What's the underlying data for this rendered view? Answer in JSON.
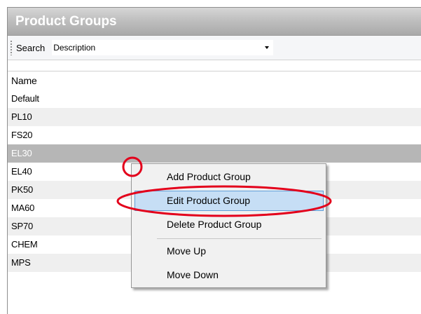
{
  "window": {
    "title": "Product Groups"
  },
  "toolbar": {
    "search_label": "Search",
    "search_value": "Description"
  },
  "grid": {
    "header": "Name",
    "rows": [
      "Default",
      "PL10",
      "FS20",
      "EL30",
      "EL40",
      "PK50",
      "MA60",
      "SP70",
      "CHEM",
      "MPS"
    ],
    "selected": "EL30"
  },
  "context_menu": {
    "items": [
      "Add Product Group",
      "Edit Product Group",
      "Delete Product Group",
      "Move Up",
      "Move Down"
    ],
    "highlighted": "Edit Product Group"
  },
  "colors": {
    "annotation": "#e3001b",
    "highlight": "#c6def5",
    "selection": "#b6b6b6"
  }
}
